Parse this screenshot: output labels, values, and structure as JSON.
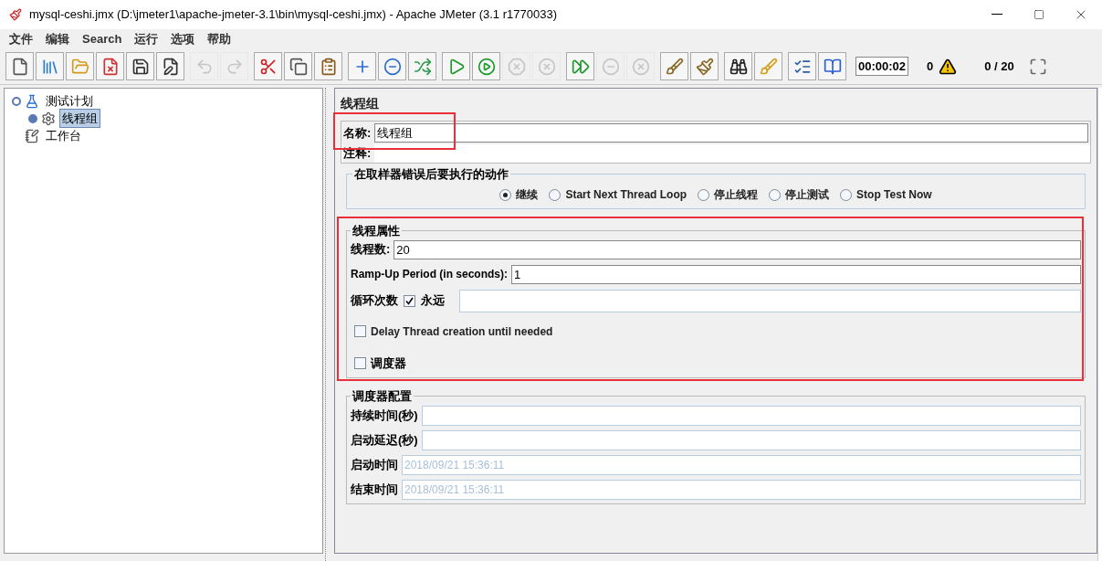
{
  "window": {
    "title": "mysql-ceshi.jmx (D:\\jmeter1\\apache-jmeter-3.1\\bin\\mysql-ceshi.jmx) - Apache JMeter (3.1 r1770033)"
  },
  "menu": [
    "文件",
    "编辑",
    "Search",
    "运行",
    "选项",
    "帮助"
  ],
  "toolbar": {
    "groups": [
      [
        {
          "disabled": false
        },
        {
          "disabled": false
        },
        {
          "disabled": false
        },
        {
          "disabled": false
        },
        {
          "disabled": false
        },
        {
          "disabled": false
        }
      ],
      [
        {
          "disabled": true
        },
        {
          "disabled": true
        }
      ],
      [
        {
          "disabled": false
        },
        {
          "disabled": false
        },
        {
          "disabled": false
        }
      ],
      [
        {
          "disabled": false
        },
        {
          "disabled": false
        },
        {
          "disabled": false
        }
      ],
      [
        {
          "disabled": false
        },
        {
          "disabled": false
        },
        {
          "disabled": true
        },
        {
          "disabled": true
        }
      ],
      [
        {
          "disabled": false
        },
        {
          "disabled": true
        },
        {
          "disabled": true
        }
      ],
      [
        {
          "disabled": false
        },
        {
          "disabled": false
        }
      ],
      [
        {
          "disabled": false
        },
        {
          "disabled": false
        }
      ],
      [
        {
          "disabled": false
        },
        {
          "disabled": false
        }
      ]
    ],
    "timer": "00:00:02",
    "error_count": "0",
    "threads": "0 / 20"
  },
  "tree": [
    {
      "label": "测试计划",
      "kind": "plan",
      "selected": false,
      "expanded": true,
      "children": [
        {
          "label": "线程组",
          "kind": "threadgroup",
          "selected": true,
          "expanded": false
        }
      ]
    },
    {
      "label": "工作台",
      "kind": "workbench",
      "selected": false
    }
  ],
  "panel": {
    "title": "线程组",
    "name_label": "名称:",
    "name_value": "线程组",
    "comment_label": "注释:",
    "on_error": {
      "title": "在取样器错误后要执行的动作",
      "options": [
        {
          "label": "继续",
          "selected": true
        },
        {
          "label": "Start Next Thread Loop",
          "selected": false
        },
        {
          "label": "停止线程",
          "selected": false
        },
        {
          "label": "停止测试",
          "selected": false
        },
        {
          "label": "Stop Test Now",
          "selected": false
        }
      ]
    },
    "thread_props": {
      "title": "线程属性",
      "threads_label": "线程数:",
      "threads_value": "20",
      "rampup_label": "Ramp-Up Period (in seconds):",
      "rampup_value": "1",
      "loop_label": "循环次数",
      "forever_label": "永远",
      "forever_checked": true,
      "delay_label": "Delay Thread creation until needed",
      "delay_checked": false,
      "scheduler_label": "调度器",
      "scheduler_checked": false
    },
    "scheduler": {
      "title": "调度器配置",
      "fields": [
        {
          "label": "持续时间(秒)"
        },
        {
          "label": "启动延迟(秒)"
        },
        {
          "label": "启动时间",
          "placeholder": "2018/09/21 15:36:11"
        },
        {
          "label": "结束时间",
          "placeholder": "2018/09/21 15:36:11"
        }
      ]
    }
  }
}
